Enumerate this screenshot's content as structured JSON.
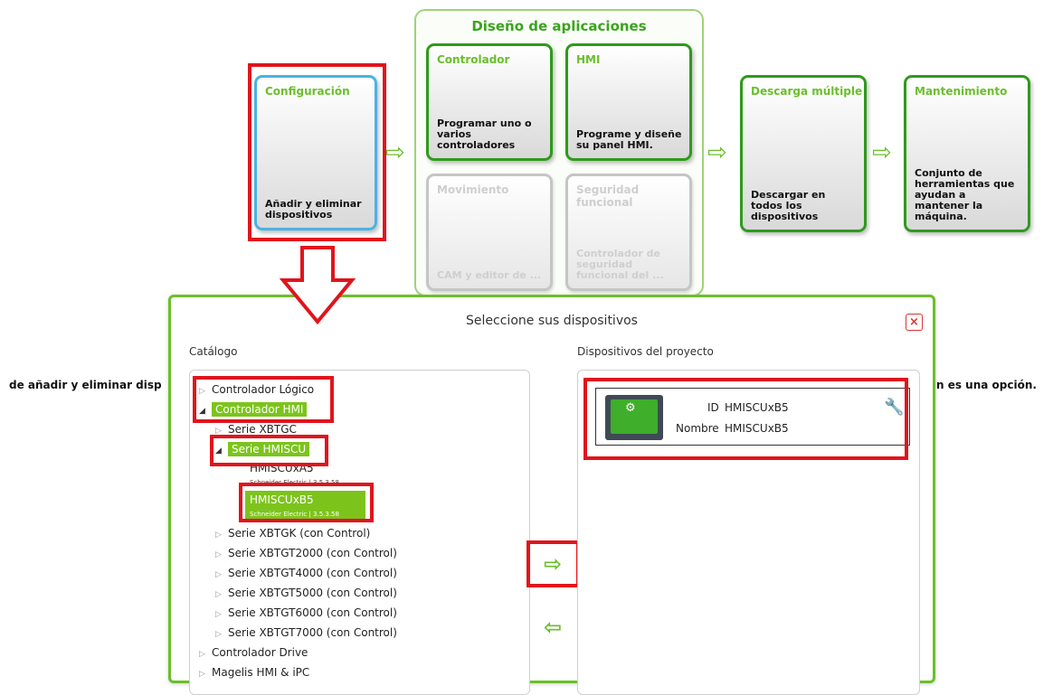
{
  "group": {
    "title": "Diseño de aplicaciones"
  },
  "tiles": {
    "configuracion": {
      "title": "Configuración",
      "desc": "Añadir y eliminar dispositivos"
    },
    "controlador": {
      "title": "Controlador",
      "desc": "Programar uno o varios controladores"
    },
    "hmi": {
      "title": "HMI",
      "desc": "Programe y diseñe su panel HMI."
    },
    "movimiento": {
      "title": "Movimiento",
      "desc": "CAM y editor de ..."
    },
    "seguridad": {
      "title": "Seguridad funcional",
      "desc": "Controlador de seguridad funcional del ..."
    },
    "descarga": {
      "title": "Descarga múltiple",
      "desc": "Descargar en todos los dispositivos"
    },
    "mantenimiento": {
      "title": "Mantenimiento",
      "desc": "Conjunto de herramientas que ayudan a mantener la máquina."
    }
  },
  "caption": {
    "left": "de añadir y eliminar disp",
    "right": "n es una opción."
  },
  "dialog": {
    "title": "Seleccione sus dispositivos",
    "close": "×",
    "catalog_label": "Catálogo",
    "project_label": "Dispositivos del proyecto",
    "tree": {
      "controlador_logico": "Controlador  Lógico",
      "controlador_hmi": "Controlador  HMI",
      "serie_xbtgc": "Serie XBTGC",
      "serie_hmiscu": "Serie HMISCU",
      "hmiscuxa5": "HMISCUxA5",
      "hmiscuxa5_sub": "Schneider Electric | 3.5.3.58",
      "hmiscuxb5": "HMISCUxB5",
      "hmiscuxb5_sub": "Schneider Electric | 3.5.3.58",
      "xbtgk": "Serie XBTGK (con Control)",
      "xbtgt2000": "Serie XBTGT2000 (con Control)",
      "xbtgt4000": "Serie XBTGT4000 (con Control)",
      "xbtgt5000": "Serie XBTGT5000 (con Control)",
      "xbtgt6000": "Serie XBTGT6000 (con Control)",
      "xbtgt7000": "Serie XBTGT7000 (con Control)",
      "drive": "Controlador  Drive",
      "magelis": "Magelis HMI & iPC"
    },
    "device": {
      "id_label": "ID",
      "id_value": "HMISCUxB5",
      "name_label": "Nombre",
      "name_value": "HMISCUxB5"
    },
    "add_icon": "⇨",
    "remove_icon": "⇦"
  },
  "colors": {
    "accent_green": "#6abf2a",
    "highlight_red": "#e1141c",
    "selection_green": "#7cc41c",
    "config_blue": "#4ab2e3"
  }
}
